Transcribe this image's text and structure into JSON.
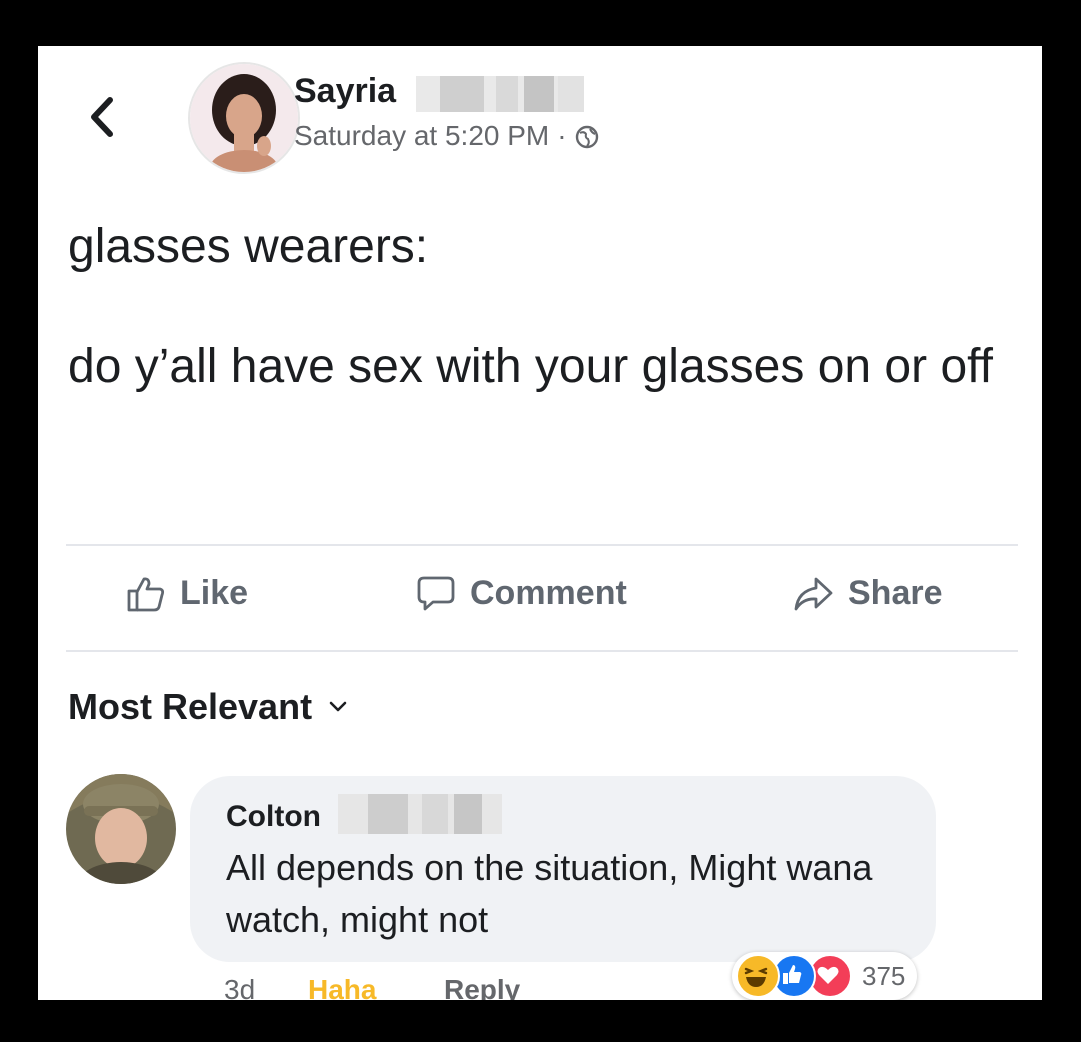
{
  "post": {
    "author": "Sayria",
    "timestamp": "Saturday at 5:20 PM",
    "separator": "·",
    "text_line1": "glasses wearers:",
    "text_line2": "do y’all have sex with your glasses on or off"
  },
  "actions": {
    "like": "Like",
    "comment": "Comment",
    "share": "Share"
  },
  "comments_sort": "Most Relevant",
  "comment": {
    "author": "Colton",
    "text": "All depends on the situation, Might wana watch, might not",
    "age": "3d",
    "reaction_label": "Haha",
    "reply_label": "Reply",
    "reaction_count": "375"
  },
  "colors": {
    "haha": "#f7b928",
    "like": "#1877f2",
    "love": "#f33e58",
    "text_muted": "#65676b"
  },
  "icons": [
    "back-chevron-icon",
    "globe-icon",
    "thumbs-up-icon",
    "comment-bubble-icon",
    "share-arrow-icon",
    "chevron-down-icon"
  ]
}
